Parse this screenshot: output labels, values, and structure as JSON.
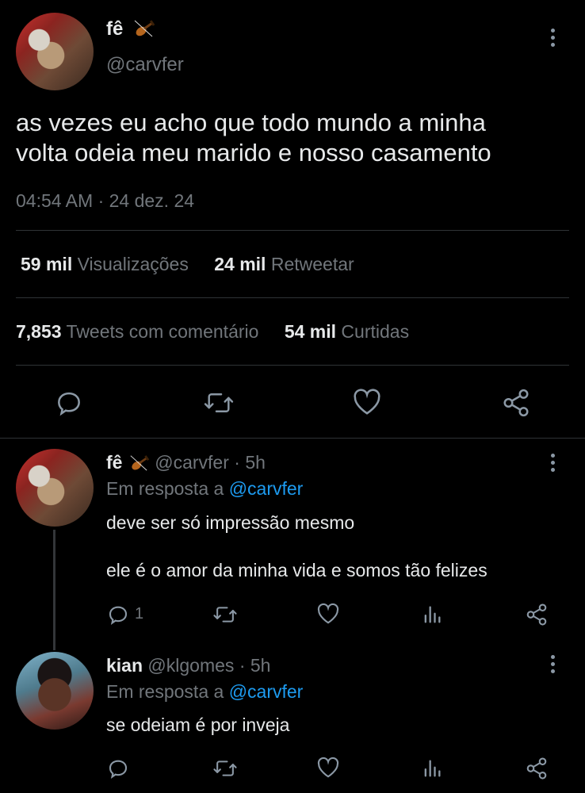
{
  "main_tweet": {
    "display_name": "fê",
    "emoji_icon": "violin-icon",
    "handle": "@carvfer",
    "text_line1": "as vezes eu acho que todo mundo a minha",
    "text_line2": "volta odeia meu marido e nosso casamento",
    "timestamp": "04:54 AM · 24 dez. 24",
    "stats": {
      "views_count": "59 mil",
      "views_label": "Visualizações",
      "retweets_count": "24 mil",
      "retweets_label": "Retweetar",
      "quotes_count": "7,853",
      "quotes_label": "Tweets com comentário",
      "likes_count": "54 mil",
      "likes_label": "Curtidas"
    }
  },
  "replies": [
    {
      "display_name": "fê",
      "handle": "@carvfer",
      "time": "· 5h",
      "reply_to_prefix": "Em resposta a",
      "reply_to_handle": "@carvfer",
      "text_line1": "deve ser só impressão mesmo",
      "text_line2": "ele é o amor da minha vida e somos tão felizes",
      "reply_count": "1"
    },
    {
      "display_name": "kian",
      "handle": "@klgomes",
      "time": "· 5h",
      "reply_to_prefix": "Em resposta a",
      "reply_to_handle": "@carvfer",
      "text_line1": "se odeiam é por inveja"
    }
  ],
  "colors": {
    "background": "#000000",
    "text": "#e7e9ea",
    "muted": "#71767b",
    "link": "#1d9bf0",
    "divider": "#2f3336"
  }
}
